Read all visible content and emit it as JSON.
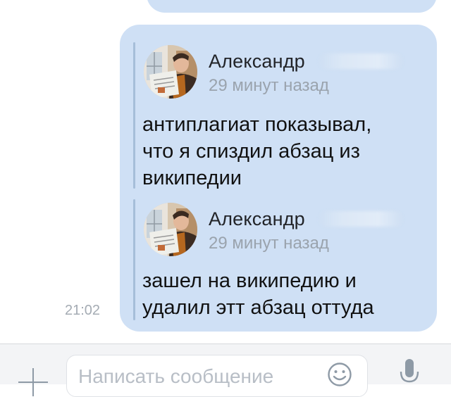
{
  "messages": {
    "timestamp": "21:02",
    "forwarded": [
      {
        "author": "Александр",
        "time_ago": "29 минут назад",
        "lines": [
          "антиплагиат показывал,",
          "что я спиздил абзац из",
          "википедии"
        ]
      },
      {
        "author": "Александр",
        "time_ago": "29 минут назад",
        "lines": [
          "зашел на википедию и",
          "удалил этт абзац оттуда"
        ]
      }
    ]
  },
  "composer": {
    "placeholder": "Написать сообщение",
    "icons": {
      "attach": "plus-icon",
      "emoji": "smile-icon",
      "voice": "mic-icon"
    }
  },
  "colors": {
    "bubble": "#cfe0f5",
    "quote_bar": "#a6bed9",
    "secondary_text": "#9aa3ad",
    "icon": "#8e9aa6"
  }
}
